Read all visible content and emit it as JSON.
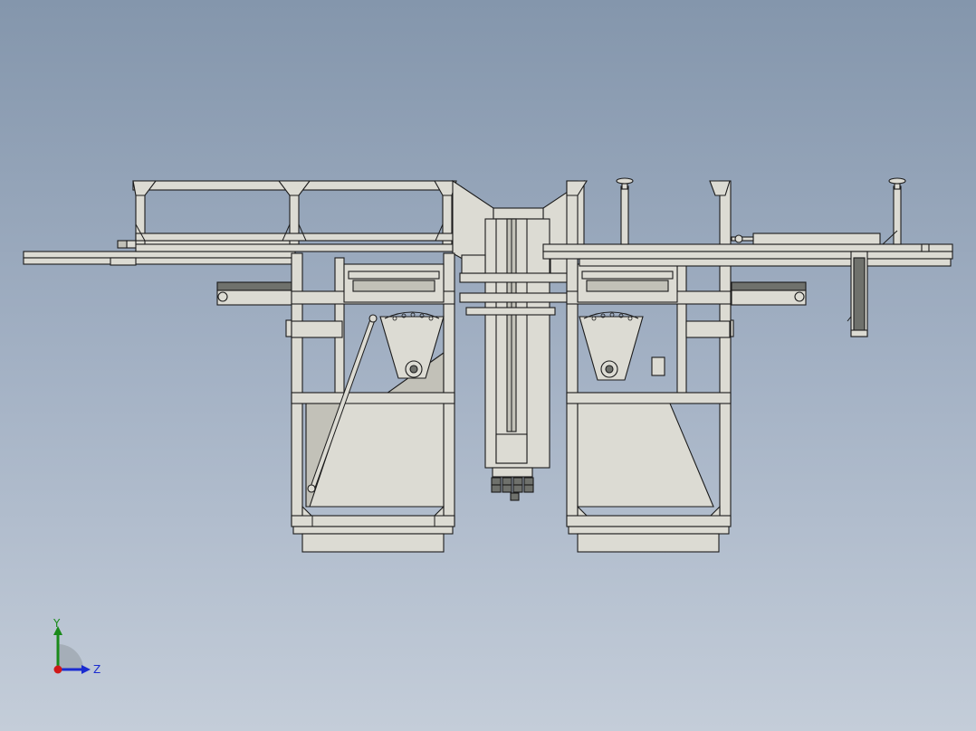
{
  "viewport": {
    "background_top": "#8496ac",
    "background_bottom": "#c4cdd9",
    "view": "front view",
    "model_colors": {
      "fill": "#dcdbd3",
      "fill_dark": "#c2c1b8",
      "edge": "#1b1b1b",
      "dark_bar": "#6f716c"
    }
  },
  "triad": {
    "y_label": "Y",
    "z_label": "Z",
    "x_axis_color": "#d01818",
    "y_axis_color": "#1a8a1a",
    "z_axis_color": "#1a2bd0"
  }
}
